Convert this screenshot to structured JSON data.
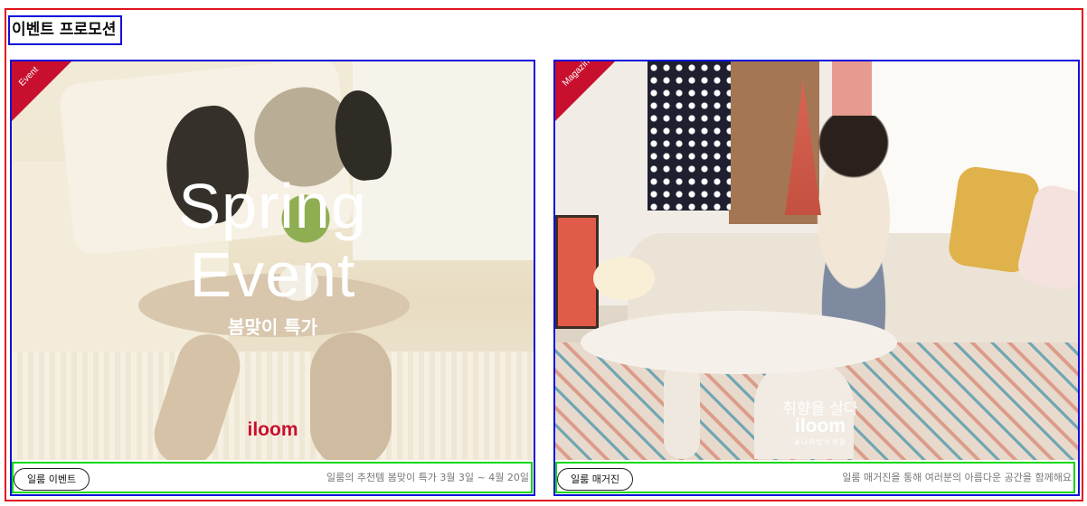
{
  "section": {
    "title": "이벤트 프로모션"
  },
  "cards": [
    {
      "ribbon": "Event",
      "banner_title_line1": "Spring",
      "banner_title_line2": "Event",
      "banner_subtitle": "봄맞이 특가",
      "banner_brand": "iloom",
      "chip_label": "일룸 이벤트",
      "description": "일룸의 추천템 봄맞이 특가 3월 3일 ~ 4월 20일"
    },
    {
      "ribbon": "Magazine",
      "banner_copy": "취향을 살다",
      "banner_brand": "iloom",
      "banner_tagline": "#나의방식생활",
      "chip_label": "일룸 매거진",
      "description": "일룸 매거진을 통해 여러분의 아름다운 공간을 함께해요"
    }
  ],
  "colors": {
    "outer_border": "#e0141e",
    "title_border": "#1010d8",
    "card_border": "#1010d8",
    "footer_border": "#10d810",
    "ribbon": "#c8102e",
    "brand_red": "#c8102e"
  }
}
